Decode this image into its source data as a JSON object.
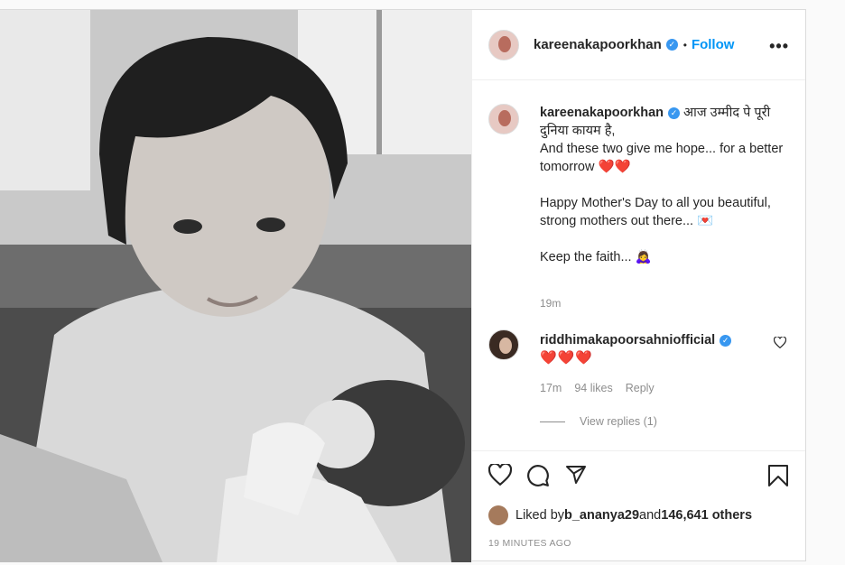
{
  "header": {
    "username": "kareenakapoorkhan",
    "dot": "•",
    "follow_label": "Follow",
    "more_label": "•••"
  },
  "caption": {
    "username": "kareenakapoorkhan",
    "line1": " आज उम्मीद पे पूरी दुनिया कायम है,",
    "line2": "And these two give me hope... for a better tomorrow ❤️❤️",
    "line3": "Happy Mother's Day to all you beautiful, strong mothers out there... 💌",
    "line4": "Keep the faith... 🙇‍♀️",
    "time": "19m"
  },
  "comment": {
    "username": "riddhimakapoorsahniofficial",
    "text": "❤️❤️❤️",
    "time": "17m",
    "likes": "94 likes",
    "reply_label": "Reply",
    "view_replies": "View replies (1)"
  },
  "footer": {
    "liked_by_prefix": "Liked by ",
    "liked_by_user": "b_ananya29",
    "liked_by_and": " and ",
    "liked_by_count": "146,641 others",
    "posted_ago": "19 MINUTES AGO"
  },
  "icons": {
    "verified": "verified-badge",
    "like": "heart-outline",
    "comment": "speech-bubble",
    "share": "paper-plane",
    "save": "bookmark"
  },
  "colors": {
    "accent": "#0095f6",
    "verified": "#3897f0",
    "heart": "#e0213a",
    "muted": "#8e8e8e"
  }
}
